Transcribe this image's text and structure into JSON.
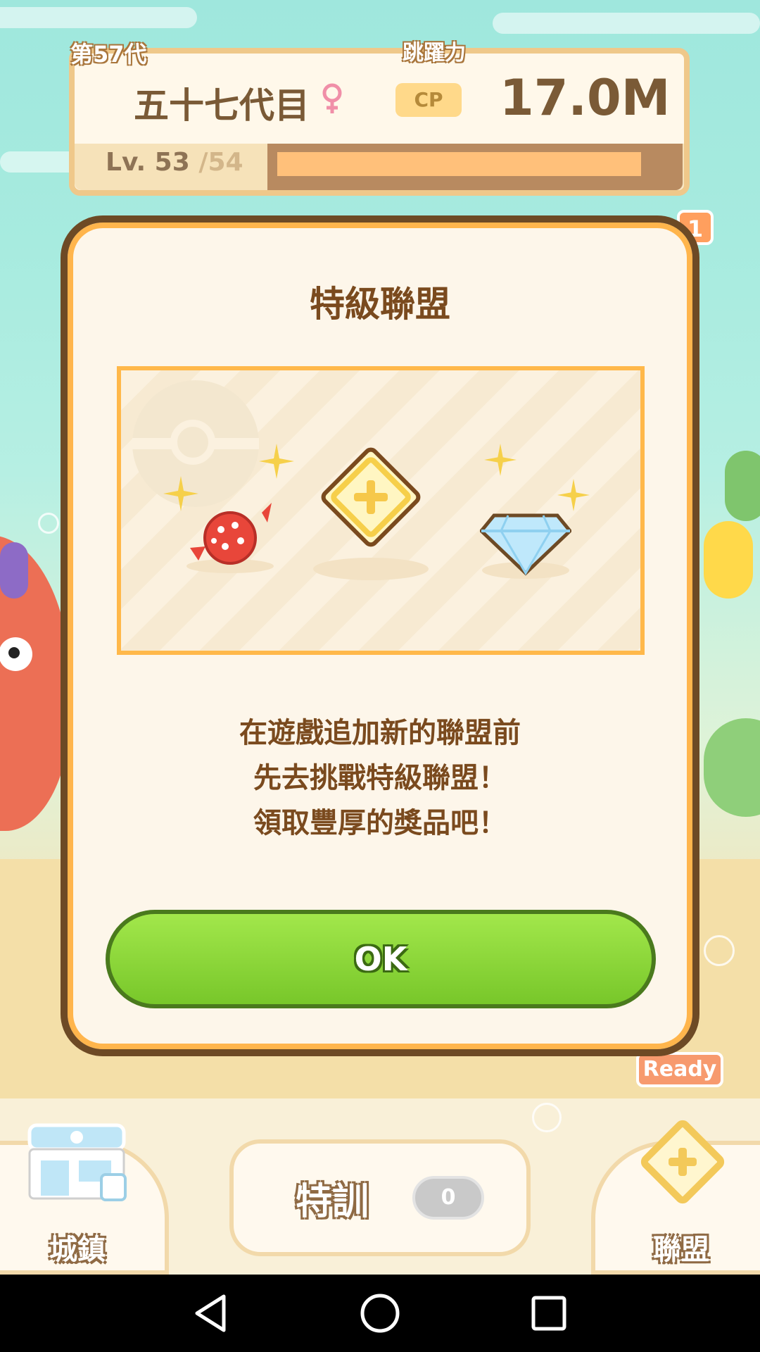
{
  "header": {
    "generation_badge": "第57代",
    "jump_label": "跳躍力",
    "name": "五十七代目",
    "gender_icon": "female-icon",
    "cp_label": "CP",
    "cp_value": "17.0M",
    "level_text": "Lv. 53",
    "level_max": "/54",
    "xp_progress": 0.92
  },
  "notification_count": "1",
  "modal": {
    "title": "特級聯盟",
    "reward_icons": [
      "candy-icon",
      "league-plus-icon",
      "diamond-icon"
    ],
    "message_lines": [
      "在遊戲追加新的聯盟前",
      "先去挑戰特級聯盟！",
      "領取豐厚的獎品吧！"
    ],
    "ok_label": "OK"
  },
  "bottom_nav": {
    "town_label": "城鎮",
    "training_label": "特訓",
    "training_count": "0",
    "league_label": "聯盟",
    "ready_label": "Ready"
  },
  "system_nav": [
    "back-icon",
    "home-icon",
    "recents-icon"
  ],
  "colors": {
    "accent_orange": "#ffb54c",
    "ok_green": "#8fd63a",
    "modal_border": "#6d4a25",
    "text_brown": "#7a4a1e"
  }
}
